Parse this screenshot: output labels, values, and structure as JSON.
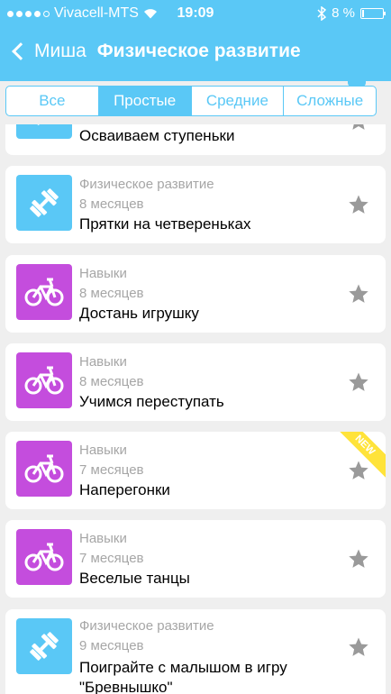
{
  "status_bar": {
    "carrier": "Vivacell-MTS",
    "time": "19:09",
    "battery_percent": "8 %",
    "battery_level": 0.08
  },
  "nav": {
    "back_label": "Миша",
    "title": "Физическое развитие"
  },
  "tabs": [
    {
      "label": "Все",
      "active": false
    },
    {
      "label": "Простые",
      "active": true
    },
    {
      "label": "Средние",
      "active": false
    },
    {
      "label": "Сложные",
      "active": false
    }
  ],
  "cards": [
    {
      "category": "",
      "age": "",
      "title": "Осваиваем ступеньки",
      "icon": "dumbbell-icon",
      "color": "#5ac8f6",
      "new": false
    },
    {
      "category": "Физическое развитие",
      "age": "8 месяцев",
      "title": "Прятки на четвереньках",
      "icon": "dumbbell-icon",
      "color": "#5ac8f6",
      "new": false
    },
    {
      "category": "Навыки",
      "age": "8 месяцев",
      "title": "Достань игрушку",
      "icon": "bicycle-icon",
      "color": "#c44ddd",
      "new": false
    },
    {
      "category": "Навыки",
      "age": "8 месяцев",
      "title": "Учимся переступать",
      "icon": "bicycle-icon",
      "color": "#c44ddd",
      "new": false
    },
    {
      "category": "Навыки",
      "age": "7 месяцев",
      "title": "Наперегонки",
      "icon": "bicycle-icon",
      "color": "#c44ddd",
      "new": true,
      "badge": "NEW"
    },
    {
      "category": "Навыки",
      "age": "7 месяцев",
      "title": "Веселые танцы",
      "icon": "bicycle-icon",
      "color": "#c44ddd",
      "new": false
    },
    {
      "category": "Физическое развитие",
      "age": "9 месяцев",
      "title": "Поиграйте с малышом в игру \"Бревнышко\"",
      "icon": "dumbbell-icon",
      "color": "#5ac8f6",
      "new": false
    }
  ]
}
